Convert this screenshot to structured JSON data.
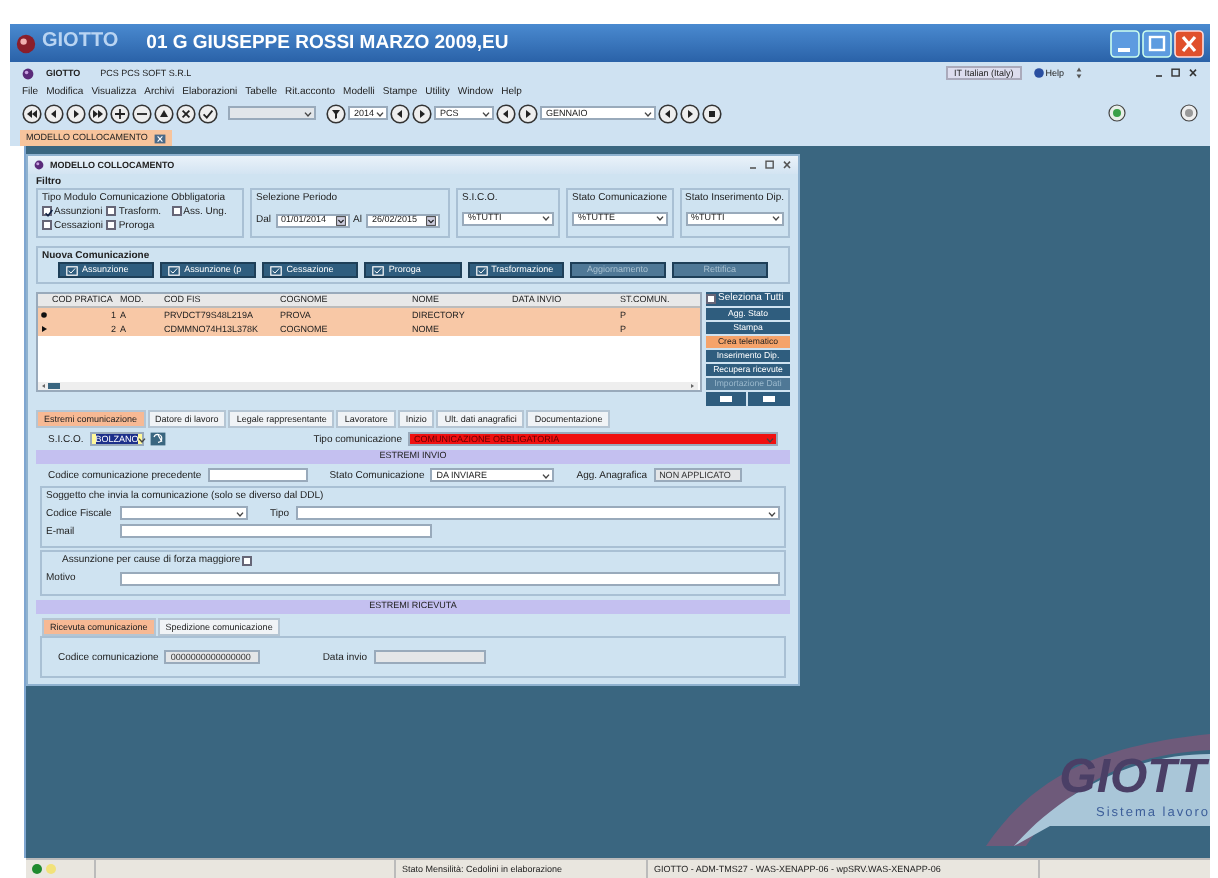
{
  "window": {
    "app_name": "GIOTTO",
    "title": "01 G GIUSEPPE ROSSI MARZO 2009,EU"
  },
  "app_bar": {
    "app_name": "GIOTTO",
    "company": "PCS  PCS SOFT S.R.L",
    "language": "IT Italian (Italy)",
    "help": "Help"
  },
  "menu": [
    "File",
    "Modifica",
    "Visualizza",
    "Archivi",
    "Elaborazioni",
    "Tabelle",
    "Rit.acconto",
    "Modelli",
    "Stampe",
    "Utility",
    "Window",
    "Help"
  ],
  "toolbar": {
    "year": "2014",
    "company": "PCS",
    "month": "GENNAIO"
  },
  "document_tabs": [
    {
      "label": "MODELLO COLLOCAMENTO",
      "selected": true
    }
  ],
  "form": {
    "title": "MODELLO COLLOCAMENTO",
    "filter": {
      "label": "Filtro",
      "module_type": {
        "label": "Tipo Modulo Comunicazione Obbligatoria",
        "options": [
          {
            "label": "Assunzioni",
            "checked": true
          },
          {
            "label": "Trasform.",
            "checked": false
          },
          {
            "label": "Ass. Ung.",
            "checked": false
          },
          {
            "label": "Cessazioni",
            "checked": false
          },
          {
            "label": "Proroga",
            "checked": false
          }
        ]
      },
      "period": {
        "label": "Selezione Periodo",
        "from_label": "Dal",
        "from": "01/01/2014",
        "to_label": "Al",
        "to": "26/02/2015"
      },
      "selects": [
        {
          "label": "S.I.C.O.",
          "value": "%TUTTI"
        },
        {
          "label": "Stato Comunicazione",
          "value": "%TUTTE"
        },
        {
          "label": "Stato Inserimento Dip.",
          "value": "%TUTTI"
        }
      ]
    },
    "new_communication": {
      "label": "Nuova Comunicazione",
      "buttons": [
        {
          "label": "Assunzione",
          "disabled": false
        },
        {
          "label": "Assunzione (p",
          "disabled": false
        },
        {
          "label": "Cessazione",
          "disabled": false
        },
        {
          "label": "Proroga",
          "disabled": false
        },
        {
          "label": "Trasformazione",
          "disabled": false
        },
        {
          "label": "Aggiornamento",
          "disabled": true
        },
        {
          "label": "Rettifica",
          "disabled": true
        }
      ]
    },
    "table": {
      "columns": [
        "COD PRATICA",
        "MOD.",
        "COD FIS",
        "COGNOME",
        "NOME",
        "DATA INVIO",
        "ST.COMUN."
      ],
      "rows": [
        {
          "current": true,
          "cod_pratica": "1",
          "mod": "A",
          "cod_fis": "PRVDCT79S48L219A",
          "cognome": "PROVA",
          "nome": "DIRECTORY",
          "st_comun": "P"
        },
        {
          "current": false,
          "cod_pratica": "2",
          "mod": "A",
          "cod_fis": "CDMMNO74H13L378K",
          "cognome": "COGNOME",
          "nome": "NOME",
          "st_comun": "P"
        }
      ]
    },
    "side_panel": {
      "select_all": {
        "label": "Seleziona Tutti",
        "checked": false
      },
      "buttons": [
        {
          "label": "Agg. Stato",
          "highlighted": false,
          "disabled": false
        },
        {
          "label": "Stampa",
          "highlighted": false,
          "disabled": false
        },
        {
          "label": "Crea telematico",
          "highlighted": true,
          "disabled": false
        },
        {
          "label": "Inserimento Dip.",
          "highlighted": false,
          "disabled": false
        },
        {
          "label": "Recupera ricevute",
          "highlighted": false,
          "disabled": false
        },
        {
          "label": "Importazione Dati",
          "highlighted": false,
          "disabled": true
        }
      ]
    },
    "detail_tabs": [
      {
        "label": "Estremi comunicazione",
        "selected": true
      },
      {
        "label": "Datore di lavoro",
        "selected": false
      },
      {
        "label": "Legale rappresentante",
        "selected": false
      },
      {
        "label": "Lavoratore",
        "selected": false
      },
      {
        "label": "Inizio",
        "selected": false
      },
      {
        "label": "Ult. dati anagrafici",
        "selected": false
      },
      {
        "label": "Documentazione",
        "selected": false
      }
    ],
    "sico": {
      "label": "S.I.C.O.",
      "value": "BOLZANO"
    },
    "communication_type": {
      "label": "Tipo comunicazione",
      "value": "COMUNICAZIONE OBBLIGATORIA"
    },
    "sending_section": {
      "title": "ESTREMI INVIO",
      "previous_code_label": "Codice comunicazione precedente",
      "status": {
        "label": "Stato Comunicazione",
        "value": "DA INVIARE"
      },
      "registry_update": {
        "label": "Agg. Anagrafica",
        "value": "NON APPLICATO"
      },
      "sender": {
        "title": "Soggetto che invia la comunicazione (solo se diverso dal DDL)",
        "tax_code_label": "Codice Fiscale",
        "type_label": "Tipo",
        "email_label": "E-mail"
      },
      "force_majeure": {
        "label": "Assunzione per cause di forza maggiore",
        "checked": false,
        "reason_label": "Motivo"
      }
    },
    "receipt_section": {
      "title": "ESTREMI RICEVUTA",
      "tabs": [
        {
          "label": "Ricevuta comunicazione",
          "selected": true
        },
        {
          "label": "Spedizione comunicazione",
          "selected": false
        }
      ],
      "code": {
        "label": "Codice comunicazione",
        "value": "0000000000000000"
      },
      "date_label": "Data invio"
    }
  },
  "logo": {
    "name": "GIOTT",
    "tagline": "Sistema lavoro"
  },
  "status_bar": {
    "indicators": [
      {
        "color": "#1f8a2e"
      },
      {
        "color": "#f2e27a"
      }
    ],
    "message": "Stato Mensilità: Cedolini in elaborazione",
    "server": "GIOTTO - ADM-TMS27 - WAS-XENAPP-06 - wpSRV.WAS-XENAPP-06"
  }
}
